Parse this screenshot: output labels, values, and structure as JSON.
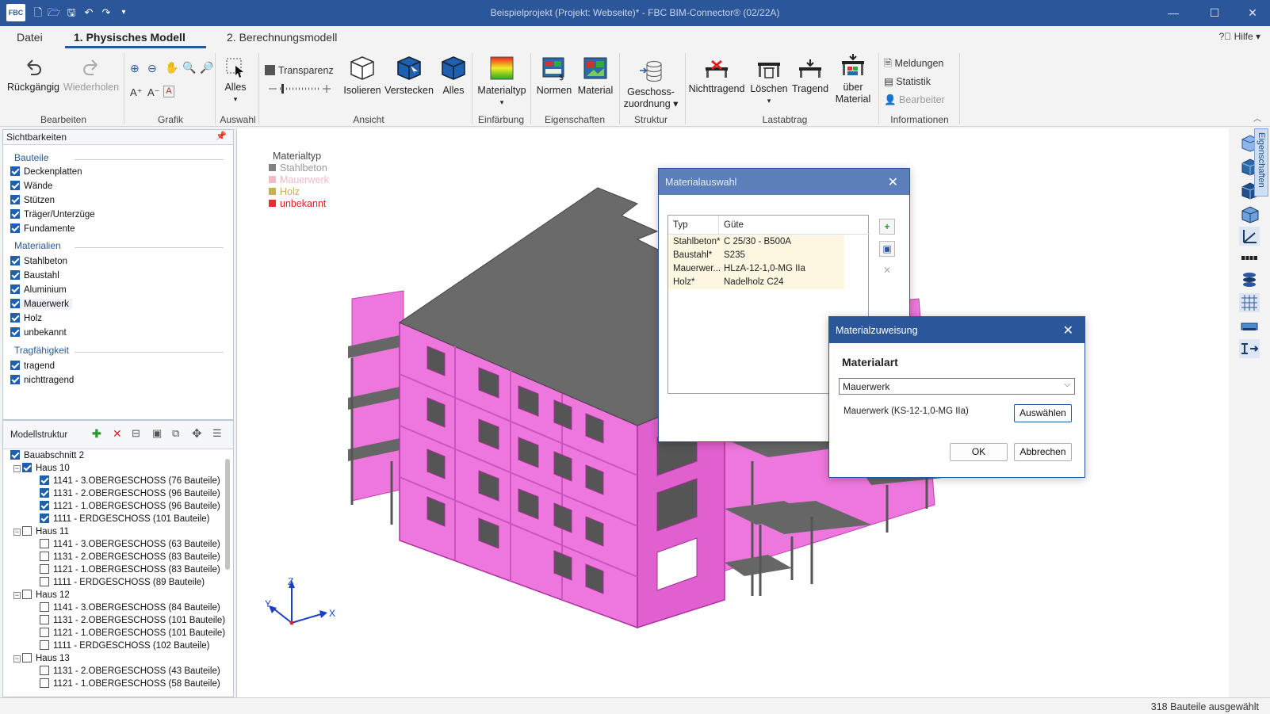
{
  "titlebar": {
    "logo": "FBC",
    "title": "Beispielprojekt (Projekt: Webseite)*   -   FBC BIM-Connector® (02/22A)"
  },
  "menu": {
    "tabs": [
      "Datei",
      "1. Physisches Modell",
      "2. Berechnungsmodell"
    ],
    "help": "Hilfe"
  },
  "ribbon": {
    "bearbeiten": {
      "label": "Bearbeiten",
      "undo": "Rückgängig",
      "redo": "Wiederholen"
    },
    "grafik": {
      "label": "Grafik"
    },
    "auswahl": {
      "label": "Auswahl",
      "alles": "Alles"
    },
    "ansicht": {
      "label": "Ansicht",
      "transparenz": "Transparenz",
      "isolieren": "Isolieren",
      "verstecken": "Verstecken",
      "alles": "Alles"
    },
    "einfaerbung": {
      "label": "Einfärbung",
      "materialtyp": "Materialtyp"
    },
    "eigenschaften": {
      "label": "Eigenschaften",
      "normen": "Normen",
      "material": "Material"
    },
    "struktur": {
      "label": "Struktur",
      "geschoss_line1": "Geschoss-",
      "geschoss_line2": "zuordnung"
    },
    "lastabtrag": {
      "label": "Lastabtrag",
      "nichttragend": "Nichttragend",
      "loeschen": "Löschen",
      "tragend": "Tragend",
      "ueber_line1": "über",
      "ueber_line2": "Material"
    },
    "informationen": {
      "label": "Informationen",
      "meldungen": "Meldungen",
      "statistik": "Statistik",
      "bearbeiter": "Bearbeiter"
    }
  },
  "sichtbarkeiten": {
    "title": "Sichtbarkeiten",
    "bauteile_label": "Bauteile",
    "bauteile": [
      "Deckenplatten",
      "Wände",
      "Stützen",
      "Träger/Unterzüge",
      "Fundamente"
    ],
    "materialien_label": "Materialien",
    "materialien": [
      "Stahlbeton",
      "Baustahl",
      "Aluminium",
      "Mauerwerk",
      "Holz",
      "unbekannt"
    ],
    "tragfaehigkeit_label": "Tragfähigkeit",
    "tragfaehigkeit": [
      "tragend",
      "nichttragend"
    ]
  },
  "modellstruktur": {
    "title": "Modellstruktur",
    "tree": [
      "Bauabschnitt 2",
      "Haus 10",
      "1141 - 3.OBERGESCHOSS (76 Bauteile)",
      "1131 - 2.OBERGESCHOSS (96 Bauteile)",
      "1121 - 1.OBERGESCHOSS (96 Bauteile)",
      "1111 - ERDGESCHOSS (101 Bauteile)",
      "Haus 11",
      "1141 - 3.OBERGESCHOSS (63 Bauteile)",
      "1131 - 2.OBERGESCHOSS (83 Bauteile)",
      "1121 - 1.OBERGESCHOSS (83 Bauteile)",
      "1111 - ERDGESCHOSS (89 Bauteile)",
      "Haus 12",
      "1141 - 3.OBERGESCHOSS (84 Bauteile)",
      "1131 - 2.OBERGESCHOSS (101 Bauteile)",
      "1121 - 1.OBERGESCHOSS (101 Bauteile)",
      "1111 - ERDGESCHOSS (102 Bauteile)",
      "Haus 13",
      "1131 - 2.OBERGESCHOSS (43 Bauteile)",
      "1121 - 1.OBERGESCHOSS (58 Bauteile)"
    ]
  },
  "legend": {
    "title": "Materialtyp",
    "items": [
      {
        "label": "Stahlbeton",
        "color": "#808080"
      },
      {
        "label": "Mauerwerk",
        "color": "#f4b8c8"
      },
      {
        "label": "Holz",
        "color": "#c8b04a"
      },
      {
        "label": "unbekannt",
        "color": "#e03030"
      }
    ]
  },
  "axes": {
    "x": "X",
    "y": "Y",
    "z": "Z"
  },
  "sidetab": "Eigenschaften",
  "materialauswahl": {
    "title": "Materialauswahl",
    "col_typ": "Typ",
    "col_guete": "Güte",
    "rows": [
      {
        "typ": "Stahlbeton*",
        "guete": "C 25/30 - B500A"
      },
      {
        "typ": "Baustahl*",
        "guete": "S235"
      },
      {
        "typ": "Mauerwer...",
        "guete": "HLzA-12-1,0-MG IIa"
      },
      {
        "typ": "Holz*",
        "guete": "Nadelholz C24"
      }
    ]
  },
  "materialzuweisung": {
    "title": "Materialzuweisung",
    "heading": "Materialart",
    "selected": "Mauerwerk",
    "current": "Mauerwerk (KS-12-1,0-MG IIa)",
    "auswaehlen": "Auswählen",
    "ok": "OK",
    "abbrechen": "Abbrechen"
  },
  "status": "318 Bauteile ausgewählt",
  "colors": {
    "accent": "#2b579a",
    "mauerwerk": "#ee77dd",
    "beton": "#6e6e6e"
  }
}
